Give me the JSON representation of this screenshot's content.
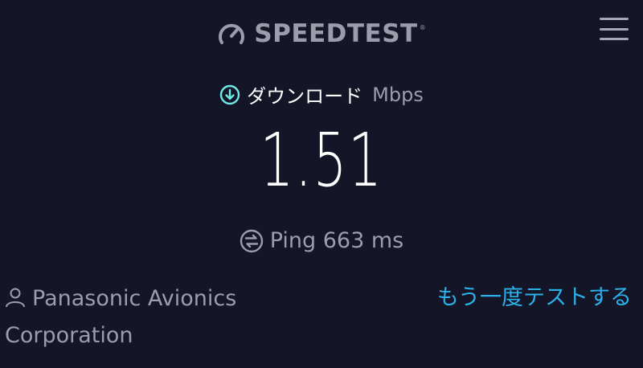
{
  "header": {
    "logo_text": "SPEEDTEST",
    "logo_trademark": "®",
    "logo_icon": "gauge-icon",
    "menu_icon": "hamburger-menu-icon"
  },
  "download": {
    "icon": "download-arrow-circle-icon",
    "label": "ダウンロード",
    "unit": "Mbps",
    "value": "1.51"
  },
  "ping": {
    "icon": "ping-circle-icon",
    "text": "Ping 663 ms"
  },
  "provider": {
    "icon": "user-icon",
    "line1": "Panasonic Avionics",
    "line2": "Corporation"
  },
  "actions": {
    "retest_label": "もう一度テストする"
  },
  "colors": {
    "background": "#141526",
    "accent_cyan": "#6fe9e6",
    "link_blue": "#2bb0ea",
    "muted_text": "#9b9dab"
  }
}
